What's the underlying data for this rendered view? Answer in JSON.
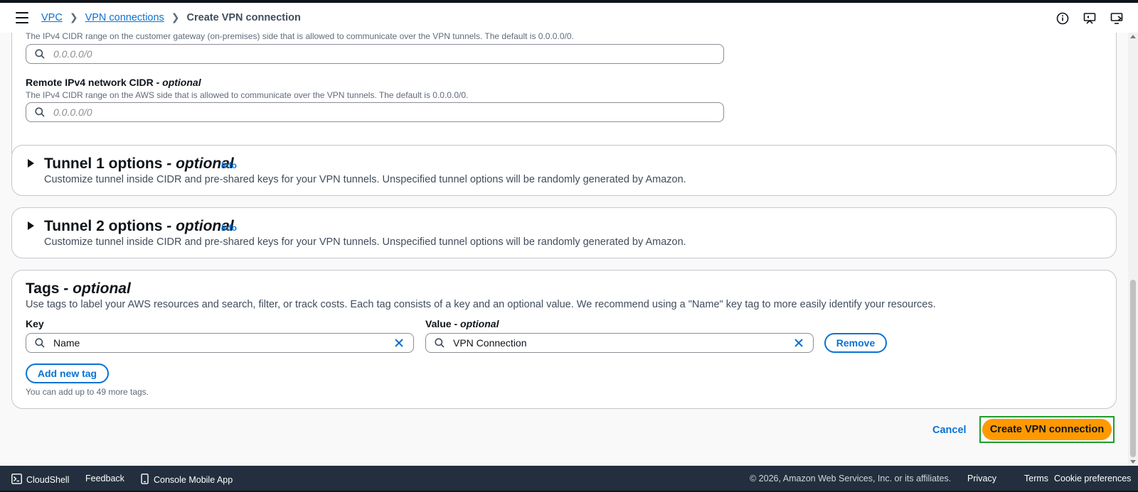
{
  "breadcrumb": {
    "items": [
      "VPC",
      "VPN connections"
    ],
    "current": "Create VPN connection"
  },
  "local_cidr": {
    "description": "The IPv4 CIDR range on the customer gateway (on-premises) side that is allowed to communicate over the VPN tunnels. The default is 0.0.0.0/0.",
    "placeholder": "0.0.0.0/0"
  },
  "remote_cidr": {
    "label": "Remote IPv4 network CIDR - ",
    "label_optional": "optional",
    "description": "The IPv4 CIDR range on the AWS side that is allowed to communicate over the VPN tunnels. The default is 0.0.0.0/0.",
    "placeholder": "0.0.0.0/0"
  },
  "tunnel1": {
    "title": "Tunnel 1 options",
    "optional": " - optional",
    "info": "Info",
    "description": "Customize tunnel inside CIDR and pre-shared keys for your VPN tunnels. Unspecified tunnel options will be randomly generated by Amazon."
  },
  "tunnel2": {
    "title": "Tunnel 2 options",
    "optional": " - optional",
    "info": "Info",
    "description": "Customize tunnel inside CIDR and pre-shared keys for your VPN tunnels. Unspecified tunnel options will be randomly generated by Amazon."
  },
  "tags": {
    "title": "Tags",
    "optional": " - optional",
    "description": "Use tags to label your AWS resources and search, filter, or track costs. Each tag consists of a key and an optional value. We recommend using a \"Name\" key tag to more easily identify your resources.",
    "key_label": "Key",
    "value_label": "Value - ",
    "value_optional": "optional",
    "rows": [
      {
        "key": "Name",
        "value": "VPN Connection"
      }
    ],
    "remove_label": "Remove",
    "add_label": "Add new tag",
    "hint": "You can add up to 49 more tags."
  },
  "actions": {
    "cancel": "Cancel",
    "create": "Create VPN connection"
  },
  "footer": {
    "cloudshell": "CloudShell",
    "feedback": "Feedback",
    "mobile_app": "Console Mobile App",
    "copyright": "© 2026, Amazon Web Services, Inc. or its affiliates.",
    "privacy": "Privacy",
    "terms": "Terms",
    "cookies": "Cookie preferences"
  },
  "colors": {
    "link": "#0972d3",
    "primary": "#ff9900",
    "footer_bg": "#232f3e",
    "highlight": "#1f9d2c"
  }
}
